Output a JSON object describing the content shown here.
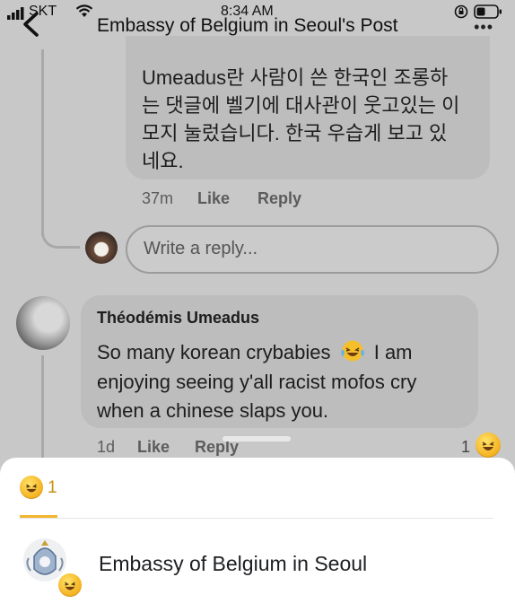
{
  "status_bar": {
    "carrier": "SKT",
    "time": "8:34 AM"
  },
  "header": {
    "title": "Embassy of Belgium in Seoul's Post",
    "more_label": "•••"
  },
  "comments": [
    {
      "text": "Umeadus란 사람이 쓴 한국인 조롱하는 댓글에 벨기에 대사관이 웃고있는 이모지 눌렀습니다.  한국 우습게 보고 있네요.",
      "lines": [
        "Umeadus란 사람이 쓴 한국인 조롱하",
        "는 댓글에 벨기에 대사관이 웃고있는 이",
        "모지 눌렀습니다.  한국 우습게 보고 있",
        "네요."
      ],
      "time": "37m",
      "like_label": "Like",
      "reply_label": "Reply"
    },
    {
      "author": "Théodémis Umeadus",
      "lines": [
        "So many korean crybabies",
        "enjoying seeing y'all racist mofos cry",
        "when a chinese slaps you."
      ],
      "line1_suffix": "I am",
      "time": "1d",
      "like_label": "Like",
      "reply_label": "Reply",
      "reaction_count": "1"
    }
  ],
  "reply_input": {
    "placeholder": "Write a reply..."
  },
  "reactions_sheet": {
    "tab_count": "1",
    "people": [
      {
        "name": "Embassy of Belgium in Seoul"
      }
    ]
  },
  "colors": {
    "accent": "#f2b631",
    "bubble": "#bdbdbd",
    "background": "#c8c8c8"
  },
  "icons": {
    "reaction": "laughing-emoji-icon",
    "back": "back-arrow-icon"
  }
}
